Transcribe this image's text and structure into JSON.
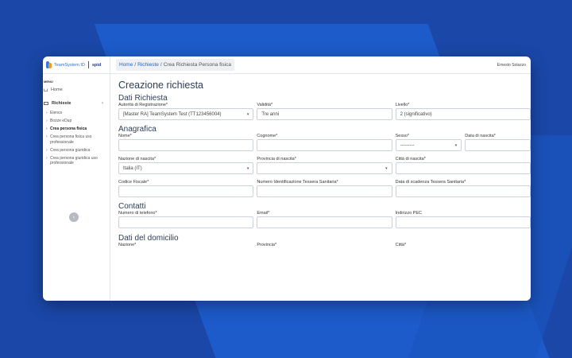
{
  "header": {
    "brand": "TeamSystem ID",
    "spid": "spid",
    "breadcrumb": [
      "Home",
      "Richieste",
      "Crea Richiesta Persona fisica"
    ],
    "user": "Ernesto Solazzo"
  },
  "sidebar": {
    "menu_label": "MENU",
    "home": "Home",
    "group": "Richieste",
    "items": [
      {
        "label": "Elenco"
      },
      {
        "label": "Bozze eDup"
      },
      {
        "label": "Crea persona fisica",
        "active": true
      },
      {
        "label": "Crea persona fisica uso professionale"
      },
      {
        "label": "Crea persona giuridica"
      },
      {
        "label": "Crea persona giuridica uso professionale"
      }
    ]
  },
  "main": {
    "page_title": "Creazione richiesta",
    "dati_richiesta": {
      "title": "Dati Richiesta",
      "autorita_label": "Autorità di Registrazione*",
      "autorita_value": "[Master RA] TeamSystem Test (TT123456004)",
      "validita_label": "Validità*",
      "validita_value": "Tre anni",
      "livello_label": "Livello*",
      "livello_value": "2 (significativo)"
    },
    "anagrafica": {
      "title": "Anagrafica",
      "nome_label": "Nome*",
      "cognome_label": "Cognome*",
      "sesso_label": "Sesso*",
      "sesso_value": "---------",
      "data_nascita_label": "Data di nascita*",
      "nazione_label": "Nazione di nascita*",
      "nazione_value": "Italia (IT)",
      "provincia_label": "Provincia di nascita*",
      "citta_label": "Città di nascita*",
      "cf_label": "Codice Fiscale*",
      "tessera_label": "Numero Identificazione Tessera Sanitaria*",
      "scadenza_label": "Data di scadenza Tessera Sanitaria*"
    },
    "contatti": {
      "title": "Contatti",
      "telefono_label": "Numero di telefono*",
      "email_label": "Email*",
      "pec_label": "Indirizzo PEC"
    },
    "domicilio": {
      "title": "Dati del domicilio",
      "nazione_label": "Nazione*",
      "provincia_label": "Provincia*",
      "citta_label": "Città*"
    }
  }
}
